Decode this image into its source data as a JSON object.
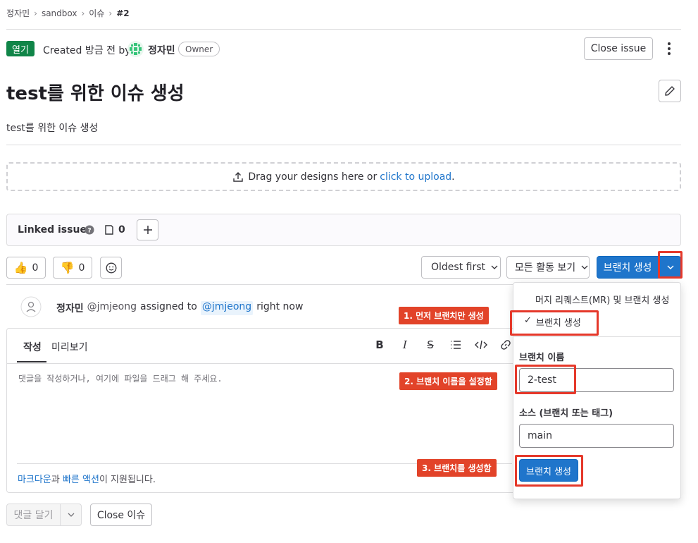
{
  "breadcrumb": {
    "items": [
      "정자민",
      "sandbox",
      "이슈"
    ],
    "current": "#2"
  },
  "header": {
    "status_badge": "열기",
    "created_text": "Created 방금 전 by",
    "author": "정자민",
    "role_badge": "Owner",
    "close_issue": "Close issue",
    "accent": "#108548"
  },
  "issue": {
    "title": "test를 위한 이슈 생성",
    "description": "test를 위한 이슈 생성"
  },
  "upload": {
    "text": "Drag your designs here or",
    "link": "click to upload",
    "suffix": "."
  },
  "linked": {
    "label": "Linked issues",
    "count": "0"
  },
  "reactions": {
    "thumbs_up": "0",
    "thumbs_down": "0"
  },
  "toolbar": {
    "sort": "Oldest first",
    "filter": "모든 활동 보기",
    "create_branch": "브랜치 생성",
    "primary_color": "#1f75cb"
  },
  "activity": {
    "user": "정자민",
    "handle": "@jmjeong",
    "action": "assigned to",
    "mention": "@jmjeong",
    "time": "right now"
  },
  "editor": {
    "tab_write": "작성",
    "tab_preview": "미리보기",
    "placeholder": "댓글을 작성하거나, 여기에 파일을 드래그 해 주세요.",
    "footer_link1": "마크다운",
    "footer_mid": "과",
    "footer_link2": "빠른 액션",
    "footer_end": "이 지원됩니다."
  },
  "footer_actions": {
    "comment": "댓글 달기",
    "close": "Close 이슈"
  },
  "dropdown": {
    "option_mr": "머지 리퀘스트(MR) 및 브랜치 생성",
    "option_branch": "브랜치 생성",
    "checkmark": "✓",
    "branch_name_label": "브랜치 이름",
    "branch_name_value": "2-test",
    "source_label": "소스 (브랜치 또는 태그)",
    "source_value": "main",
    "submit": "브랜치 생성"
  },
  "annotations": {
    "step1": "1. 먼저 브랜치만 생성",
    "step2": "2. 브랜치 이름을 설정함",
    "step3": "3. 브랜치를 생성함",
    "color": "#e24329"
  }
}
